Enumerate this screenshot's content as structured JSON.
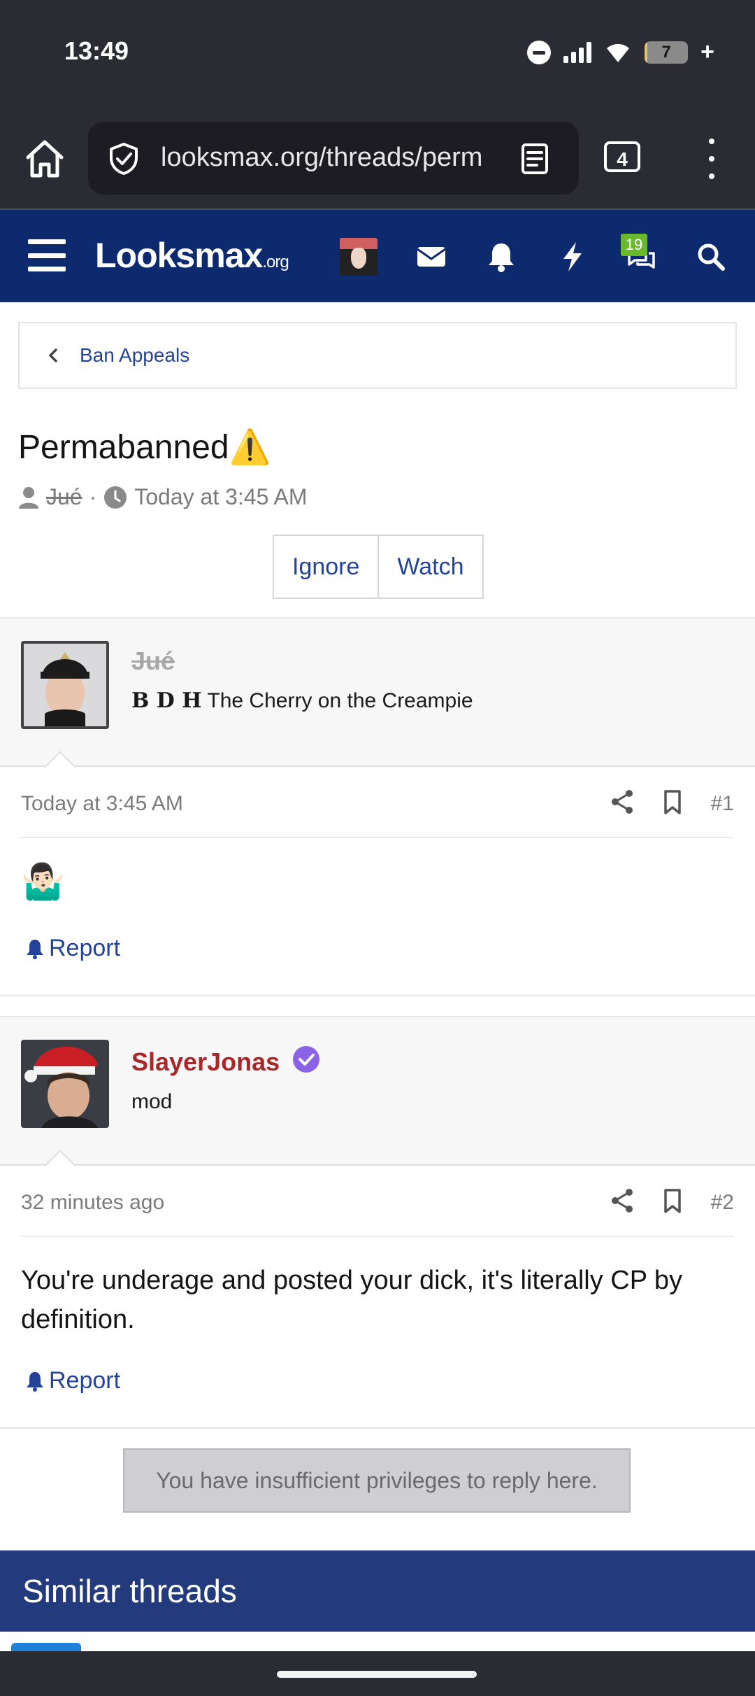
{
  "status_bar": {
    "time": "13:49",
    "battery": "7",
    "battery_level": 0.07
  },
  "browser": {
    "url": "looksmax.org/threads/perm",
    "tab_count": "4"
  },
  "site_header": {
    "logo": "Lo",
    "logo_main": "Looksmax",
    "logo_suffix": ".org",
    "conversations_badge": "19",
    "icons": [
      "menu-icon",
      "avatar",
      "envelope-icon",
      "bell-icon",
      "bolt-icon",
      "chat-icon",
      "search-icon"
    ],
    "accent_color": "#0e2a6e"
  },
  "breadcrumb": {
    "label": "Ban Appeals"
  },
  "thread": {
    "title": "Permabanned",
    "title_emoji": "⚠️",
    "author": "Jué",
    "date": "Today at 3:45 AM",
    "ignore_label": "Ignore",
    "watch_label": "Watch"
  },
  "posts": [
    {
      "username": "Jué",
      "user_title_prefix": "𝐁 𝐃 𝐇",
      "user_title": "The Cherry on the Creampie",
      "date": "Today at 3:45 AM",
      "number": "#1",
      "body": "🤷🏻‍♂️",
      "report_label": "Report"
    },
    {
      "username": "SlayerJonas",
      "user_title": "mod",
      "date": "32 minutes ago",
      "number": "#2",
      "body": "You're underage and posted your dick, it's literally CP by definition.",
      "report_label": "Report",
      "username_color": "#a8282a",
      "verified_color": "#8a63e6"
    }
  ],
  "reply_notice": "You have insufficient privileges to reply here.",
  "similar_threads": {
    "heading": "Similar threads"
  }
}
